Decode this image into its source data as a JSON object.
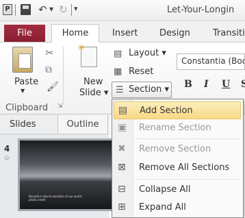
{
  "title_bar": {
    "app_icon": "P",
    "document_title": "Let-Your-Longin",
    "icons": [
      "powerpoint-icon",
      "save-icon",
      "undo-icon",
      "redo-icon",
      "customize-qat-icon"
    ]
  },
  "tabs": {
    "file": "File",
    "home": "Home",
    "insert": "Insert",
    "design": "Design",
    "transitions": "Transiti"
  },
  "ribbon": {
    "clipboard": {
      "paste": "Paste",
      "group_label": "Clipboard"
    },
    "slides": {
      "new_slide_line1": "New",
      "new_slide_line2": "Slide",
      "layout": "Layout",
      "reset": "Reset",
      "section": "Section"
    },
    "font": {
      "font_name": "Constantia (Boo",
      "bold": "B",
      "italic": "I",
      "underline": "U",
      "strike": "S"
    }
  },
  "panel": {
    "slides_tab": "Slides",
    "outline_tab": "Outline",
    "slide_number": "4",
    "thumb_text_line1": "Beautiful natural wonders of our world",
    "thumb_text_line2": "photo credit"
  },
  "section_menu": {
    "items": [
      {
        "label": "Add Section",
        "enabled": true,
        "highlighted": true,
        "icon": "add-section-icon"
      },
      {
        "label": "Rename Section",
        "enabled": false,
        "icon": "rename-section-icon"
      },
      {
        "label": "Remove Section",
        "enabled": false,
        "icon": "remove-section-icon"
      },
      {
        "label": "Remove All Sections",
        "enabled": true,
        "icon": "remove-all-sections-icon"
      },
      {
        "label": "Collapse All",
        "enabled": true,
        "icon": "collapse-all-icon"
      },
      {
        "label": "Expand All",
        "enabled": true,
        "icon": "expand-all-icon"
      }
    ]
  },
  "colors": {
    "file_tab": "#a42b3e",
    "menu_highlight": "#f8d985"
  }
}
